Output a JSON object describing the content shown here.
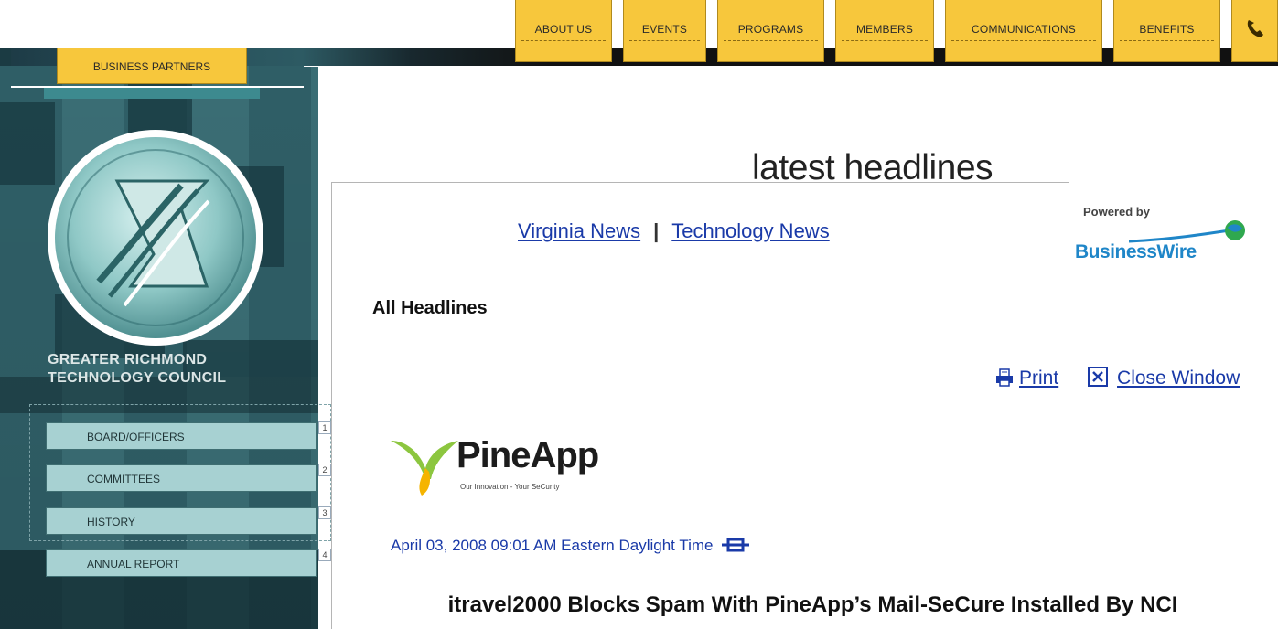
{
  "top_nav": {
    "items": [
      "ABOUT US",
      "EVENTS",
      "PROGRAMS",
      "MEMBERS",
      "COMMUNICATIONS",
      "BENEFITS"
    ]
  },
  "business_partners_label": "BUSINESS PARTNERS",
  "org": {
    "name_line1": "GREATER RICHMOND",
    "name_line2": "TECHNOLOGY COUNCIL"
  },
  "side_menu": {
    "items": [
      {
        "label": "BOARD/OFFICERS",
        "number": "1"
      },
      {
        "label": "COMMITTEES",
        "number": "2"
      },
      {
        "label": "HISTORY",
        "number": "3"
      },
      {
        "label": "ANNUAL REPORT",
        "number": "4"
      }
    ]
  },
  "headlines_title": "latest headlines",
  "news_links": {
    "virginia": "Virginia News",
    "separator": "|",
    "technology": "Technology News"
  },
  "powered_by": {
    "label": "Powered by",
    "brand": "BusinessWire"
  },
  "section_title": "All Headlines",
  "tools": {
    "print": "Print",
    "close": "Close Window"
  },
  "article": {
    "logo_word": "PineApp",
    "logo_tagline": "Our Innovation - Your SeCurity",
    "dateline": "April 03, 2008 09:01 AM Eastern Daylight Time",
    "title": "itravel2000 Blocks Spam With PineApp’s Mail-SeCure Installed By NCI"
  },
  "colors": {
    "nav_yellow": "#f7c73c",
    "sidebar_teal": "#2f5e66",
    "menu_button": "#a7d1d2",
    "link_blue": "#1a3aa8",
    "businesswire_blue": "#1f86c8"
  },
  "icons": [
    "phone-icon",
    "council-logo-icon",
    "print-icon",
    "close-icon",
    "link-icon",
    "pineapp-logo-icon",
    "businesswire-globe-icon"
  ]
}
